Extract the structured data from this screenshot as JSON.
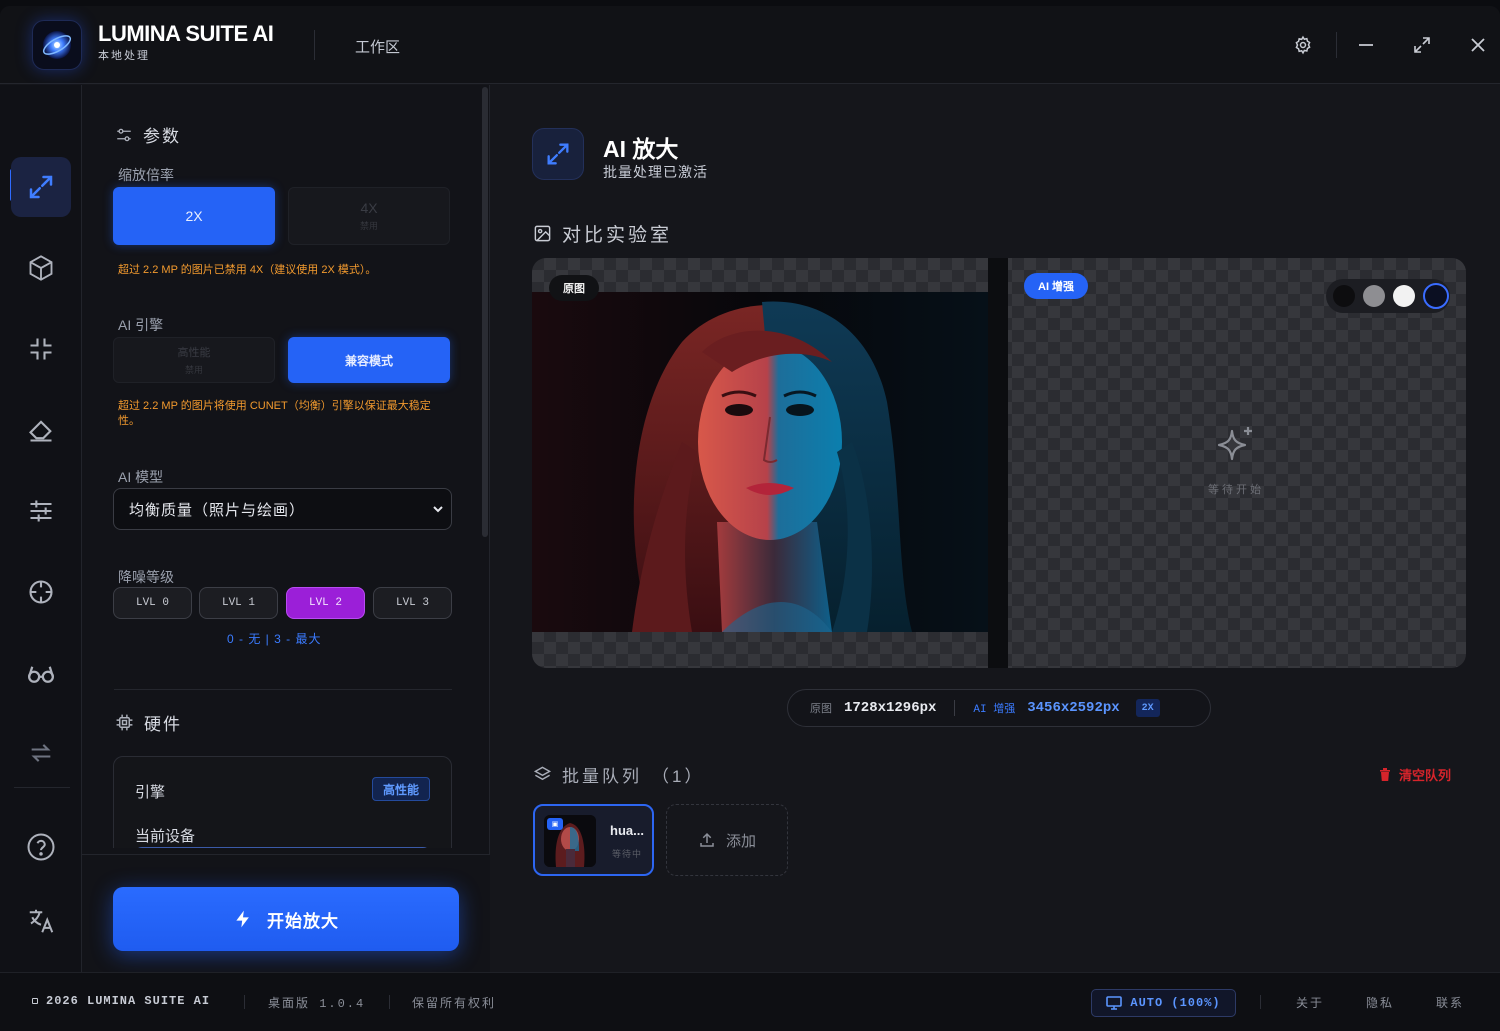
{
  "app": {
    "title": "LUMINA SUITE AI",
    "subtitle": "本地处理",
    "workspace_label": "工作区"
  },
  "window_controls": [
    "settings-icon",
    "minimize-icon",
    "maximize-icon",
    "close-icon"
  ],
  "rail": {
    "items": [
      {
        "icon": "upscale-icon",
        "active": true
      },
      {
        "icon": "cube-icon",
        "active": false
      },
      {
        "icon": "compress-icon",
        "active": false
      },
      {
        "icon": "eraser-icon",
        "active": false
      },
      {
        "icon": "sliders-icon",
        "active": false
      },
      {
        "icon": "crosshair-icon",
        "active": false
      },
      {
        "icon": "glasses-icon",
        "active": false
      },
      {
        "icon": "swap-icon",
        "active": false
      },
      {
        "icon": "help-icon",
        "active": false
      },
      {
        "icon": "translate-icon",
        "active": false
      }
    ]
  },
  "panel": {
    "params_title": "参数",
    "scale": {
      "label": "缩放倍率",
      "options": [
        {
          "label": "2X",
          "sub": "",
          "selected": true
        },
        {
          "label": "4X",
          "sub": "禁用",
          "selected": false
        }
      ],
      "warning": "超过 2.2 MP 的图片已禁用 4X（建议使用 2X 模式）。"
    },
    "engine": {
      "label": "AI 引擎",
      "options": [
        {
          "label": "高性能",
          "sub": "禁用",
          "selected": false
        },
        {
          "label": "兼容模式",
          "selected": true
        }
      ],
      "warning": "超过 2.2 MP 的图片将使用 CUNET（均衡）引擎以保证最大稳定性。"
    },
    "model": {
      "label": "AI 模型",
      "selected": "均衡质量（照片与绘画）"
    },
    "noise": {
      "label": "降噪等级",
      "levels": [
        "LVL 0",
        "LVL 1",
        "LVL 2",
        "LVL 3"
      ],
      "selected_index": 2,
      "hint": "0 - 无 | 3 - 最大"
    },
    "hardware": {
      "title": "硬件",
      "engine_label": "引擎",
      "engine_badge": "高性能",
      "device_label": "当前设备"
    },
    "start_button": "开始放大"
  },
  "main": {
    "title": "AI 放大",
    "subtitle": "批量处理已激活",
    "lab_title": "对比实验室",
    "compare": {
      "original_tag": "原图",
      "ai_tag": "AI 增强",
      "waiting_text": "等待开始",
      "bg_swatches": [
        "#0d0d0f",
        "#8e8e92",
        "#f2f2f2",
        "#0b0f22"
      ]
    },
    "resolution": {
      "original_label": "原图",
      "original_value": "1728x1296px",
      "ai_label": "AI 增强",
      "ai_value": "3456x2592px",
      "scale_badge": "2X"
    },
    "queue": {
      "title": "批量队列",
      "count": "（1）",
      "clear_label": "清空队列",
      "items": [
        {
          "name": "hua...",
          "status": "等待中"
        }
      ],
      "add_label": "添加"
    }
  },
  "footer": {
    "copyright": "2026 LUMINA SUITE AI",
    "version": "桌面版 1.0.4",
    "rights": "保留所有权利",
    "display_mode": "AUTO (100%)",
    "links": [
      "关于",
      "隐私",
      "联系"
    ]
  },
  "colors": {
    "accent": "#2563f6",
    "warning": "#f29a2e",
    "noise_selected": "#9b1fd8",
    "danger": "#d6242b"
  }
}
